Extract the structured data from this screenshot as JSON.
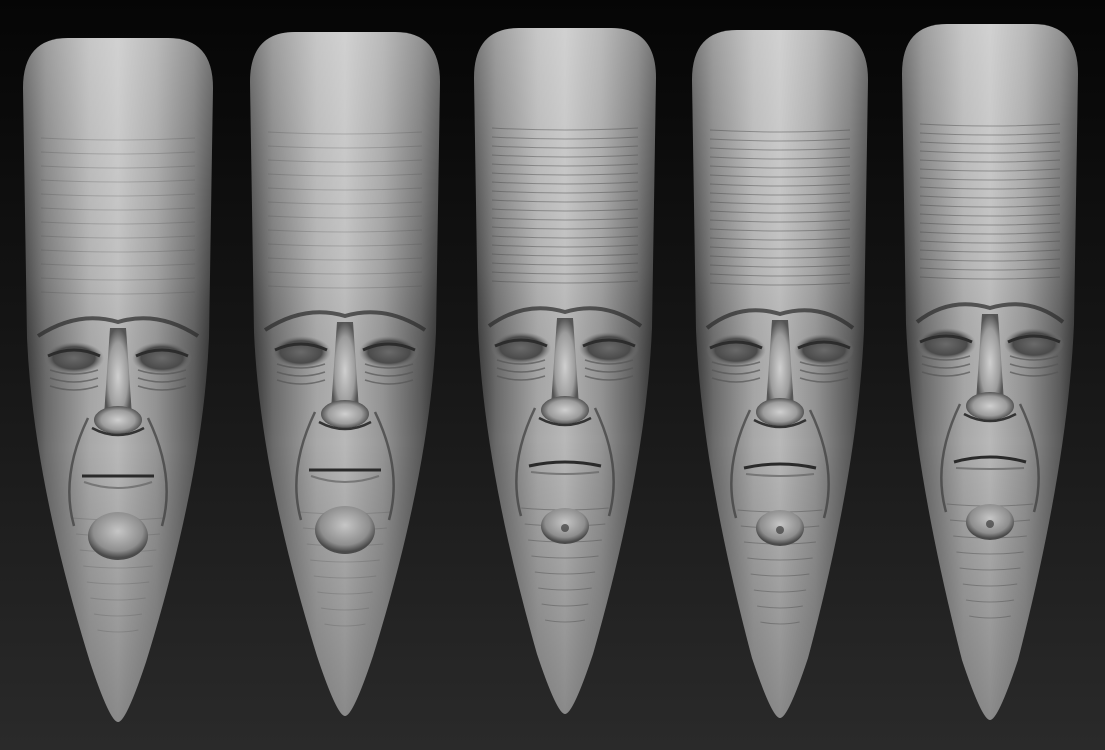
{
  "scene": {
    "background_top": "#050505",
    "background_bottom": "#2a2a2a",
    "material_color": "#9a9a9a",
    "material_highlight": "#d8d8d8",
    "material_shadow": "#3a3a3a"
  },
  "sculpts": [
    {
      "id": "sculpt-1",
      "expression": "neutral"
    },
    {
      "id": "sculpt-2",
      "expression": "neutral"
    },
    {
      "id": "sculpt-3",
      "expression": "frown"
    },
    {
      "id": "sculpt-4",
      "expression": "frown"
    },
    {
      "id": "sculpt-5",
      "expression": "scowl"
    }
  ]
}
